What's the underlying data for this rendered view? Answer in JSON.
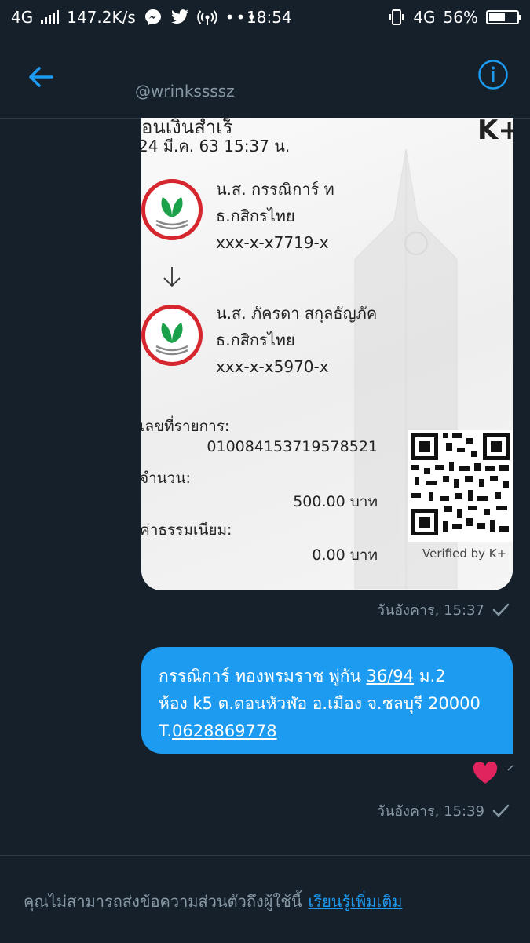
{
  "status_bar": {
    "network_left": "4G",
    "speed": "147.2K/s",
    "time": "18:54",
    "network_right": "4G",
    "battery": "56%",
    "battery_level": 0.56
  },
  "header": {
    "handle": "@wrinkssssz"
  },
  "slip": {
    "title_partial": "อนเงินสำเร็",
    "brand": "K+",
    "date": "24 มี.ค. 63  15:37 น.",
    "sender": {
      "name": "น.ส. กรรณิการ์ ท",
      "bank": "ธ.กสิกรไทย",
      "account": "xxx-x-x7719-x"
    },
    "receiver": {
      "name": "น.ส. ภัครดา สกุลธัญภัค",
      "bank": "ธ.กสิกรไทย",
      "account": "xxx-x-x5970-x"
    },
    "ref_label": "เลขที่รายการ:",
    "ref_value": "010084153719578521",
    "amount_label": "จำนวน:",
    "amount_value": "500.00 บาท",
    "fee_label": "ค่าธรรมเนียม:",
    "fee_value": "0.00 บาท",
    "verified": "Verified by K+"
  },
  "messages": [
    {
      "meta": "วันอังคาร, 15:37"
    },
    {
      "line1_a": "กรรณิการ์ ทองพรมราช พู่กัน ",
      "line1_link": "36/94",
      "line1_b": " ม.2",
      "line2": "ห้อง k5 ต.ดอนหัวฬ่อ อ.เมือง จ.ชลบุรี 20000",
      "line3_a": "T.",
      "line3_link": "0628869778",
      "meta": "วันอังคาร, 15:39"
    }
  ],
  "footer": {
    "text": "คุณไม่สามารถส่งข้อความส่วนตัวถึงผู้ใช้นี้",
    "link": "เรียนรู้เพิ่มเติม"
  },
  "colors": {
    "background": "#15202b",
    "accent": "#1d9bf0",
    "heart": "#e0245e"
  },
  "icons": [
    "back-arrow-icon",
    "info-icon",
    "check-icon",
    "heart-icon",
    "messenger-icon",
    "twitter-icon",
    "hotspot-icon",
    "vibrate-icon"
  ]
}
